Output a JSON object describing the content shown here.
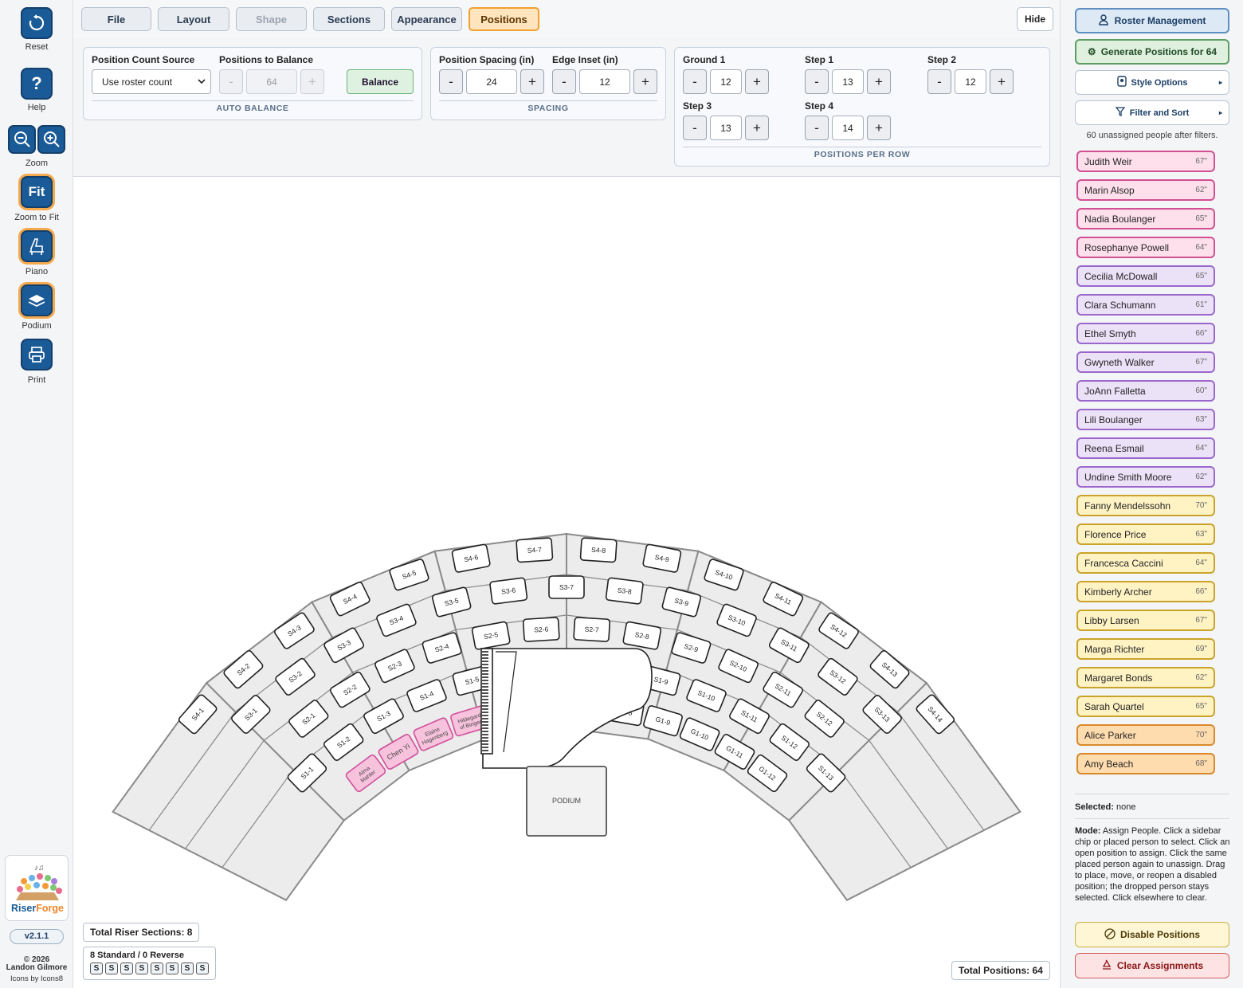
{
  "rail": {
    "reset": "Reset",
    "help": "Help",
    "help_glyph": "?",
    "zoom": "Zoom",
    "fit_glyph": "Fit",
    "zoom_to_fit": "Zoom to Fit",
    "piano": "Piano",
    "podium": "Podium",
    "print": "Print",
    "logo_riser": "Riser",
    "logo_forge": "Forge",
    "version": "v2.1.1",
    "copyright": "© 2026",
    "author": "Landon Gilmore",
    "icons_credit": "Icons by Icons8"
  },
  "tabs": [
    {
      "label": "File",
      "state": "normal"
    },
    {
      "label": "Layout",
      "state": "normal"
    },
    {
      "label": "Shape",
      "state": "disabled"
    },
    {
      "label": "Sections",
      "state": "normal"
    },
    {
      "label": "Appearance",
      "state": "normal"
    },
    {
      "label": "Positions",
      "state": "active"
    }
  ],
  "hide_label": "Hide",
  "auto_balance": {
    "title": "AUTO BALANCE",
    "source_label": "Position Count Source",
    "source_value": "Use roster count",
    "balance_label": "Positions to Balance",
    "balance_value": "64",
    "balance_button": "Balance",
    "minus": "-",
    "plus": "+"
  },
  "spacing": {
    "title": "SPACING",
    "spacing_label": "Position Spacing (in)",
    "spacing_value": "24",
    "inset_label": "Edge Inset (in)",
    "inset_value": "12"
  },
  "per_row": {
    "title": "POSITIONS PER ROW",
    "rows": [
      {
        "label": "Ground 1",
        "value": "12"
      },
      {
        "label": "Step 1",
        "value": "13"
      },
      {
        "label": "Step 2",
        "value": "12"
      },
      {
        "label": "Step 3",
        "value": "13"
      },
      {
        "label": "Step 4",
        "value": "14"
      }
    ]
  },
  "stage": {
    "rows": [
      {
        "prefix": "G1",
        "count": 12,
        "assigned": {
          "1": "Alma Mahler",
          "2": "Chen Yi",
          "3": "Elaine Hagenberg",
          "4": "Hildegard of Bingen"
        }
      },
      {
        "prefix": "S1",
        "count": 13,
        "assigned": {}
      },
      {
        "prefix": "S2",
        "count": 12,
        "assigned": {}
      },
      {
        "prefix": "S3",
        "count": 13,
        "assigned": {}
      },
      {
        "prefix": "S4",
        "count": 14,
        "assigned": {}
      }
    ],
    "podium": "PODIUM",
    "colors": {
      "riser": "#ececec",
      "riser_stroke": "#8a8a8a",
      "assigned_fill": "#f7c3dc",
      "assigned_stroke": "#d0509a"
    }
  },
  "footer": {
    "total_sections": "Total Riser Sections: 8",
    "std_rev": "8 Standard / 0 Reverse",
    "section_badges": [
      "S",
      "S",
      "S",
      "S",
      "S",
      "S",
      "S",
      "S"
    ],
    "total_positions": "Total Positions: 64"
  },
  "sidebar": {
    "roster": "Roster Management",
    "generate": "Generate Positions for 64",
    "style": "Style Options",
    "filter": "Filter and Sort",
    "count_text": "60 unassigned people after filters.",
    "people": [
      {
        "name": "Judith Weir",
        "height": "67\"",
        "color": "pink"
      },
      {
        "name": "Marin Alsop",
        "height": "62\"",
        "color": "pink"
      },
      {
        "name": "Nadia Boulanger",
        "height": "65\"",
        "color": "pink"
      },
      {
        "name": "Rosephanye Powell",
        "height": "64\"",
        "color": "pink"
      },
      {
        "name": "Cecilia McDowall",
        "height": "65\"",
        "color": "purple"
      },
      {
        "name": "Clara Schumann",
        "height": "61\"",
        "color": "purple"
      },
      {
        "name": "Ethel Smyth",
        "height": "66\"",
        "color": "purple"
      },
      {
        "name": "Gwyneth Walker",
        "height": "67\"",
        "color": "purple"
      },
      {
        "name": "JoAnn Falletta",
        "height": "60\"",
        "color": "purple"
      },
      {
        "name": "Lili Boulanger",
        "height": "63\"",
        "color": "purple"
      },
      {
        "name": "Reena Esmail",
        "height": "64\"",
        "color": "purple"
      },
      {
        "name": "Undine Smith Moore",
        "height": "62\"",
        "color": "purple"
      },
      {
        "name": "Fanny Mendelssohn",
        "height": "70\"",
        "color": "yellow"
      },
      {
        "name": "Florence Price",
        "height": "63\"",
        "color": "yellow"
      },
      {
        "name": "Francesca Caccini",
        "height": "64\"",
        "color": "yellow"
      },
      {
        "name": "Kimberly Archer",
        "height": "66\"",
        "color": "yellow"
      },
      {
        "name": "Libby Larsen",
        "height": "67\"",
        "color": "yellow"
      },
      {
        "name": "Marga Richter",
        "height": "69\"",
        "color": "yellow"
      },
      {
        "name": "Margaret Bonds",
        "height": "62\"",
        "color": "yellow"
      },
      {
        "name": "Sarah Quartel",
        "height": "65\"",
        "color": "yellow"
      },
      {
        "name": "Alice Parker",
        "height": "70\"",
        "color": "orange"
      },
      {
        "name": "Amy Beach",
        "height": "68\"",
        "color": "orange"
      }
    ],
    "selected_label": "Selected:",
    "selected_value": "none",
    "mode_label": "Mode:",
    "mode_text": "Assign People. Click a sidebar chip or placed person to select. Click an open position to assign. Click the same placed person again to unassign. Drag to place, move, or reopen a disabled position; the dropped person stays selected. Click elsewhere to clear.",
    "disable": "Disable Positions",
    "clear": "Clear Assignments",
    "chip_colors": {
      "pink": [
        "#fde0ec",
        "#d24f92"
      ],
      "purple": [
        "#ece2f8",
        "#9b67cc"
      ],
      "yellow": [
        "#fff3c4",
        "#caa32a"
      ],
      "orange": [
        "#ffdcae",
        "#d9882a"
      ]
    }
  }
}
